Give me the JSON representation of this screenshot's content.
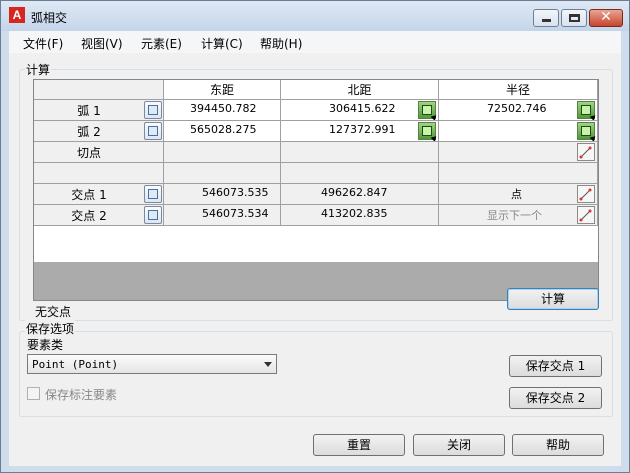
{
  "window": {
    "title": "弧相交",
    "close_glyph": "✕"
  },
  "menu": [
    "文件(F)",
    "视图(V)",
    "元素(E)",
    "计算(C)",
    "帮助(H)"
  ],
  "calc_group": {
    "label": "计算"
  },
  "grid": {
    "headers": [
      "东距",
      "北距",
      "半径"
    ],
    "rows": [
      {
        "label": "弧 1",
        "easting": "394450.782",
        "northing": "306415.622",
        "radius": "72502.746"
      },
      {
        "label": "弧 2",
        "easting": "565028.275",
        "northing": "127372.991",
        "radius": ""
      },
      {
        "label": "切点",
        "easting": "",
        "northing": "",
        "radius": ""
      },
      {
        "label": "",
        "easting": "",
        "northing": "",
        "radius": ""
      },
      {
        "label": "交点 1",
        "easting": "546073.535",
        "northing": "496262.847",
        "radius": "点"
      },
      {
        "label": "交点 2",
        "easting": "546073.534",
        "northing": "413202.835",
        "radius": "显示下一个"
      }
    ]
  },
  "status_text": "无交点",
  "calculate_button": "计算",
  "save_group": {
    "label": "保存选项",
    "element_type_label": "要素类",
    "element_type_value": "Point (Point)",
    "save_annotation_label": "保存标注要素",
    "save_annotation_checked": false,
    "save_point1_button": "保存交点 1",
    "save_point2_button": "保存交点 2"
  },
  "footer": {
    "reset": "重置",
    "close": "关闭",
    "help": "帮助"
  }
}
